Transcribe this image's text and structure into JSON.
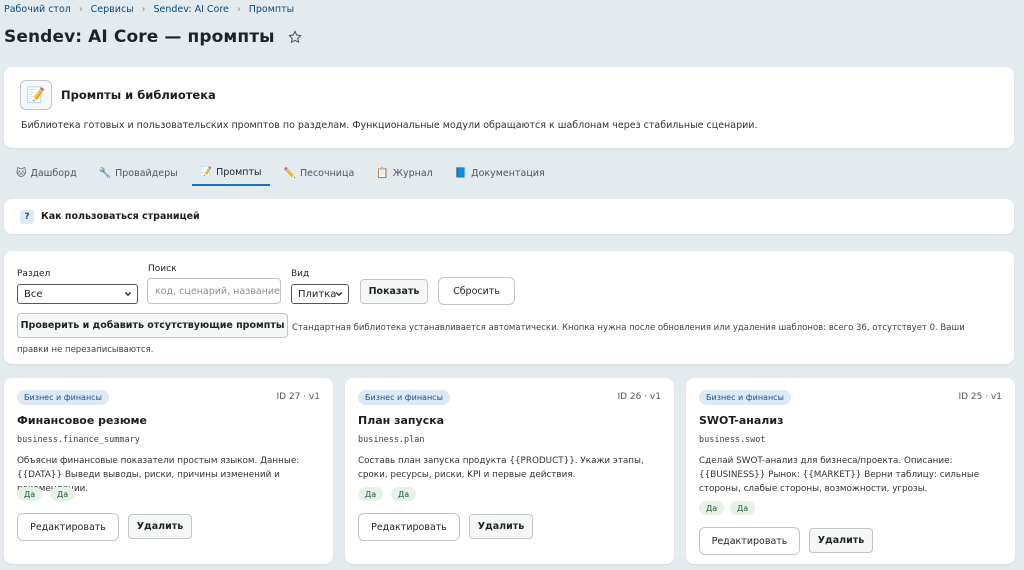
{
  "breadcrumb": [
    "Рабочий стол",
    "Сервисы",
    "Sendev: AI Core",
    "Промпты"
  ],
  "page_title": "Sendev: AI Core — промпты",
  "intro": {
    "icon": "📝",
    "title": "Промпты и библиотека",
    "description": "Библиотека готовых и пользовательских промптов по разделам. Функциональные модули обращаются к шаблонам через стабильные сценарии."
  },
  "tabs": [
    {
      "icon": "🐱",
      "label": "Дашборд"
    },
    {
      "icon": "🔧",
      "label": "Провайдеры"
    },
    {
      "icon": "📝",
      "label": "Промпты"
    },
    {
      "icon": "✏️",
      "label": "Песочница"
    },
    {
      "icon": "📋",
      "label": "Журнал"
    },
    {
      "icon": "📘",
      "label": "Документация"
    }
  ],
  "help": {
    "icon": "?",
    "title": "Как пользоваться страницей"
  },
  "filters": {
    "section_label": "Раздел",
    "section_value": "Все",
    "search_label": "Поиск",
    "search_placeholder": "код, сценарий, название",
    "view_label": "Вид",
    "view_value": "Плитка",
    "show_button": "Показать",
    "reset_button": "Сбросить",
    "check_button": "Проверить и добавить отсутствующие промпты",
    "note": "Стандартная библиотека устанавливается автоматически. Кнопка нужна после обновления или удаления шаблонов: всего 36, отсутствует 0. Ваши правки не перезаписываются."
  },
  "cards": [
    {
      "badge": "Бизнес и финансы",
      "id": "ID 27 · v1",
      "title": "Финансовое резюме",
      "code": "business.finance_summary",
      "description": "Объясни финансовые показатели простым языком. Данные: {{DATA}} Выведи выводы, риски, причины изменений и рекомендации.",
      "chips": [
        "Да",
        "Да"
      ],
      "edit": "Редактировать",
      "delete": "Удалить"
    },
    {
      "badge": "Бизнес и финансы",
      "id": "ID 26 · v1",
      "title": "План запуска",
      "code": "business.plan",
      "description": "Составь план запуска продукта {{PRODUCT}}. Укажи этапы, сроки, ресурсы, риски, KPI и первые действия.",
      "chips": [
        "Да",
        "Да"
      ],
      "edit": "Редактировать",
      "delete": "Удалить"
    },
    {
      "badge": "Бизнес и финансы",
      "id": "ID 25 · v1",
      "title": "SWOT-анализ",
      "code": "business.swot",
      "description": "Сделай SWOT-анализ для бизнеса/проекта. Описание: {{BUSINESS}} Рынок: {{MARKET}} Верни таблицу: сильные стороны, слабые стороны, возможности, угрозы.",
      "chips": [
        "Да",
        "Да"
      ],
      "edit": "Редактировать",
      "delete": "Удалить"
    }
  ]
}
